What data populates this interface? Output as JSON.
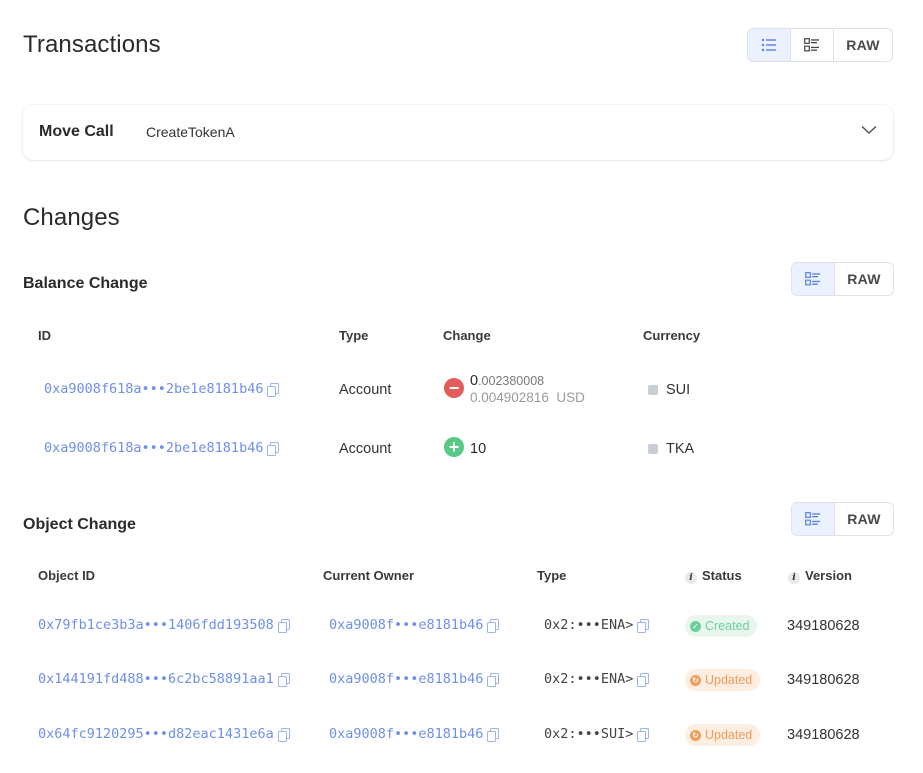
{
  "transactions": {
    "title": "Transactions",
    "view_toggle": {
      "raw_label": "RAW",
      "icons": [
        "list-icon",
        "detail-list-icon"
      ],
      "active": "list-icon"
    },
    "move_call": {
      "label": "Move Call",
      "value": "CreateTokenA"
    }
  },
  "changes": {
    "title": "Changes",
    "balance_change": {
      "title": "Balance Change",
      "raw_label": "RAW",
      "headers": [
        "ID",
        "Type",
        "Change",
        "Currency"
      ],
      "rows": [
        {
          "id": "0xa9008f618a•••2be1e8181b46",
          "type": "Account",
          "change_sign": "minus",
          "change_int": "0",
          "change_frac": ".002380008",
          "usd_amount": "0.004902816",
          "usd_label": "USD",
          "currency": "SUI"
        },
        {
          "id": "0xa9008f618a•••2be1e8181b46",
          "type": "Account",
          "change_sign": "plus",
          "change_int": "10",
          "change_frac": "",
          "usd_amount": "",
          "usd_label": "",
          "currency": "TKA"
        }
      ]
    },
    "object_change": {
      "title": "Object Change",
      "raw_label": "RAW",
      "headers": [
        "Object ID",
        "Current Owner",
        "Type",
        "Status",
        "Version"
      ],
      "rows": [
        {
          "object_id": "0x79fb1ce3b3a•••1406fdd193508",
          "owner": "0xa9008f•••e8181b46",
          "type": "0x2:•••ENA>",
          "status": "Created",
          "version": "349180628"
        },
        {
          "object_id": "0x144191fd488•••6c2bc58891aa1",
          "owner": "0xa9008f•••e8181b46",
          "type": "0x2:•••ENA>",
          "status": "Updated",
          "version": "349180628"
        },
        {
          "object_id": "0x64fc9120295•••d82eac1431e6a",
          "owner": "0xa9008f•••e8181b46",
          "type": "0x2:•••SUI>",
          "status": "Updated",
          "version": "349180628"
        }
      ]
    }
  },
  "colors": {
    "link": "#6f8fe8",
    "created": "#6ccf98",
    "updated": "#ee9d5a",
    "minus": "#e25c5c",
    "plus": "#58c985",
    "active_toggle": "#ebf1fe"
  }
}
